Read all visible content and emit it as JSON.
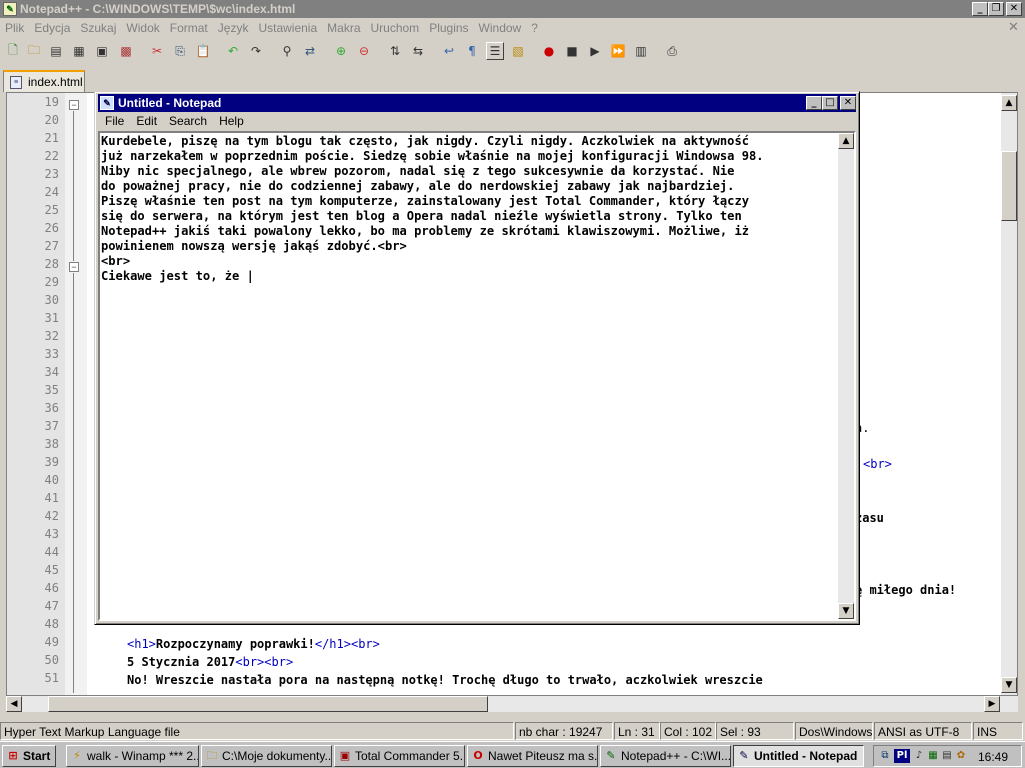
{
  "npp": {
    "title": "Notepad++ - C:\\WINDOWS\\TEMP\\$wc\\index.html",
    "menu": [
      "Plik",
      "Edycja",
      "Szukaj",
      "Widok",
      "Format",
      "Język",
      "Ustawienia",
      "Makra",
      "Uruchom",
      "Plugins",
      "Window",
      "?"
    ],
    "tab": "index.html",
    "line_numbers": [
      "19",
      "20",
      "21",
      "22",
      "23",
      "24",
      "25",
      "26",
      "27",
      "28",
      "29",
      "30",
      "31",
      "32",
      "33",
      "34",
      "35",
      "36",
      "37",
      "38",
      "39",
      "40",
      "41",
      "42",
      "43",
      "44",
      "45",
      "46",
      "47",
      "48",
      "49",
      "50",
      "51"
    ],
    "visible_fragments": {
      "l37": "a.",
      "l39": "<br>",
      "l42": "zasu",
      "l46": "ę miłego dnia!"
    },
    "code_lines": {
      "l49_open": "<h1>",
      "l49_text": "Rozpoczynamy poprawki!",
      "l49_close": "</h1><br>",
      "l50_text": "5 Stycznia 2017",
      "l50_tags": "<br><br>",
      "l51_text": "No! Wreszcie nastała pora na następną notkę! Trochę długo to trwało, aczkolwiek wreszcie"
    },
    "status": {
      "filetype": "Hyper Text Markup Language file",
      "nbchar": "nb char : 19247",
      "ln": "Ln : 31",
      "col": "Col : 102",
      "sel": "Sel : 93",
      "eol": "Dos\\Windows",
      "encoding": "ANSI as UTF-8",
      "mode": "INS"
    }
  },
  "notepad": {
    "title": "Untitled - Notepad",
    "menu": [
      "File",
      "Edit",
      "Search",
      "Help"
    ],
    "text": "Kurdebele, piszę na tym blogu tak często, jak nigdy. Czyli nigdy. Aczkolwiek na aktywność\njuż narzekałem w poprzednim poście. Siedzę sobie właśnie na mojej konfiguracji Windowsa 98.\nNiby nic specjalnego, ale wbrew pozorom, nadal się z tego sukcesywnie da korzystać. Nie\ndo poważnej pracy, nie do codziennej zabawy, ale do nerdowskiej zabawy jak najbardziej.\nPiszę właśnie ten post na tym komputerze, zainstalowany jest Total Commander, który łączy\nsię do serwera, na którym jest ten blog a Opera nadal nieźle wyświetla strony. Tylko ten\nNotepad++ jakiś taki powalony lekko, bo ma problemy ze skrótami klawiszowymi. Możliwe, iż\npowinienem nowszą wersję jakąś zdobyć.<br>\n<br>\nCiekawe jest to, że |"
  },
  "taskbar": {
    "start": "Start",
    "tasks": [
      {
        "label": "walk - Winamp *** 2...",
        "icon": "winamp-icon"
      },
      {
        "label": "C:\\Moje dokumenty...",
        "icon": "folder-icon"
      },
      {
        "label": "Total Commander 5....",
        "icon": "total-commander-icon"
      },
      {
        "label": "Nawet Piteusz ma s...",
        "icon": "opera-icon"
      },
      {
        "label": "Notepad++ - C:\\WI...",
        "icon": "notepadpp-icon"
      },
      {
        "label": "Untitled - Notepad",
        "icon": "notepad-icon"
      }
    ],
    "lang": "Pl",
    "clock": "16:49"
  },
  "colors": {
    "active_title": "#000080",
    "inactive_title": "#808080",
    "tag": "#0000c0",
    "desktop": "#008080"
  }
}
